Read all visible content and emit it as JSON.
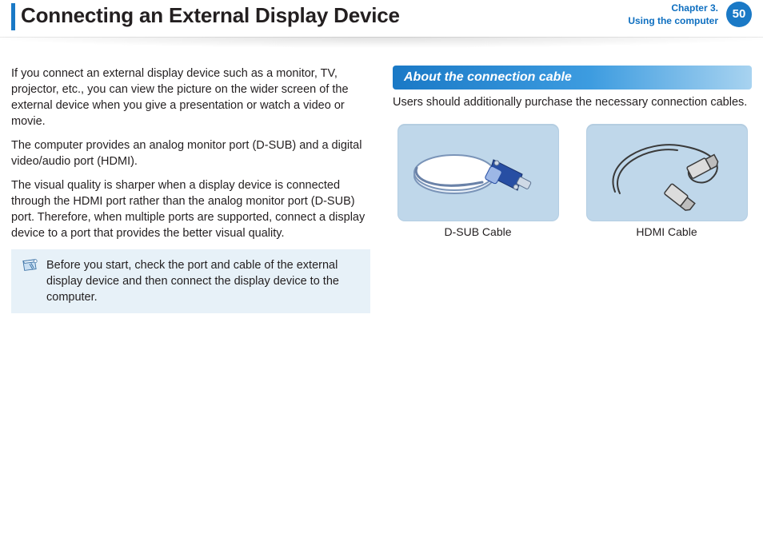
{
  "header": {
    "title": "Connecting an External Display Device",
    "chapter_line1": "Chapter 3.",
    "chapter_line2": "Using the computer",
    "page_number": "50"
  },
  "left": {
    "p1": "If you connect an external display device such as a monitor, TV, projector, etc., you can view the picture on the wider screen of the external device when you give a presentation or watch a video or movie.",
    "p2": "The computer provides an analog monitor port (D-SUB) and a digital video/audio port (HDMI).",
    "p3": "The visual quality is sharper when a display device is connected through the HDMI port rather than the analog monitor port (D-SUB) port. Therefore, when multiple ports are supported, connect a display device to a port that provides the better visual quality.",
    "note": "Before you start, check the port and cable of the external display device and then connect the display device to the computer."
  },
  "right": {
    "section_title": "About the connection cable",
    "section_p": "Users should additionally purchase the necessary connection cables.",
    "cables": [
      {
        "label": "D-SUB Cable"
      },
      {
        "label": "HDMI Cable"
      }
    ]
  }
}
